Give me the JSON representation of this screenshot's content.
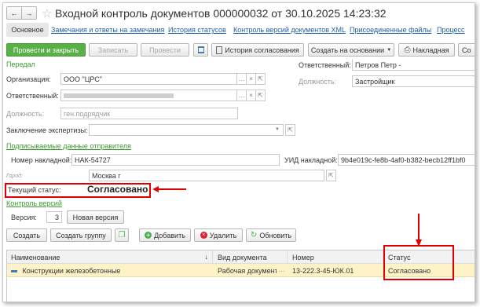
{
  "window": {
    "title": "Входной контроль документов 000000032 от 30.10.2025 14:23:32"
  },
  "tabs": [
    "Основное",
    "Замечания и ответы на замечания",
    "История статусов",
    "Контроль версий документов XML",
    "Присоединенные файлы",
    "Процесс"
  ],
  "toolbar": {
    "post_close": "Провести и закрыть",
    "save": "Записать",
    "post": "Провести",
    "approval_history": "История согласования",
    "create_based": "Создать на основании",
    "invoice": "Накладная",
    "more": "Со"
  },
  "sections": {
    "transferred": "Передал",
    "signed_data": "Подписываемые данные отправителя",
    "versions": "Контроль версий"
  },
  "fields": {
    "org_label": "Организация:",
    "org_value": "ООО \"ЦРС\"",
    "resp_label": "Ответственный:",
    "position_label": "Должность:",
    "position_value": "ген.подрядчик",
    "resp_right_label": "Ответственный:",
    "resp_right_value": "Петров Петр -",
    "position_right_label": "Должность:",
    "position_right_value": "Застройщик",
    "expertise_label": "Заключение экспертизы:",
    "invoice_num_label": "Номер накладной:",
    "invoice_num_value": "НАК-54727",
    "uid_label": "УИД накладной:",
    "uid_value": "9b4e019c-fe8b-4af0-b382-becb12ff1bf0",
    "city_label": "Город:",
    "city_value": "Москва г"
  },
  "status": {
    "label": "Текущий статус:",
    "value": "Согласовано"
  },
  "version": {
    "label": "Версия:",
    "value": "3",
    "new_button": "Новая версия"
  },
  "table_toolbar": {
    "create": "Создать",
    "create_group": "Создать группу",
    "add": "Добавить",
    "delete": "Удалить",
    "refresh": "Обновить"
  },
  "table": {
    "columns": [
      "Наименование",
      "Вид документа",
      "Номер",
      "Статус"
    ],
    "rows": [
      [
        "Конструкции железобетонные",
        "Рабочая документ...",
        "13-222.3-45-ЮК.01",
        "Согласовано"
      ]
    ]
  },
  "colors": {
    "accent_green": "#59b046",
    "link_blue": "#1e5fa8",
    "highlight_red": "#e00000",
    "selected_row": "#fdf3c7"
  }
}
